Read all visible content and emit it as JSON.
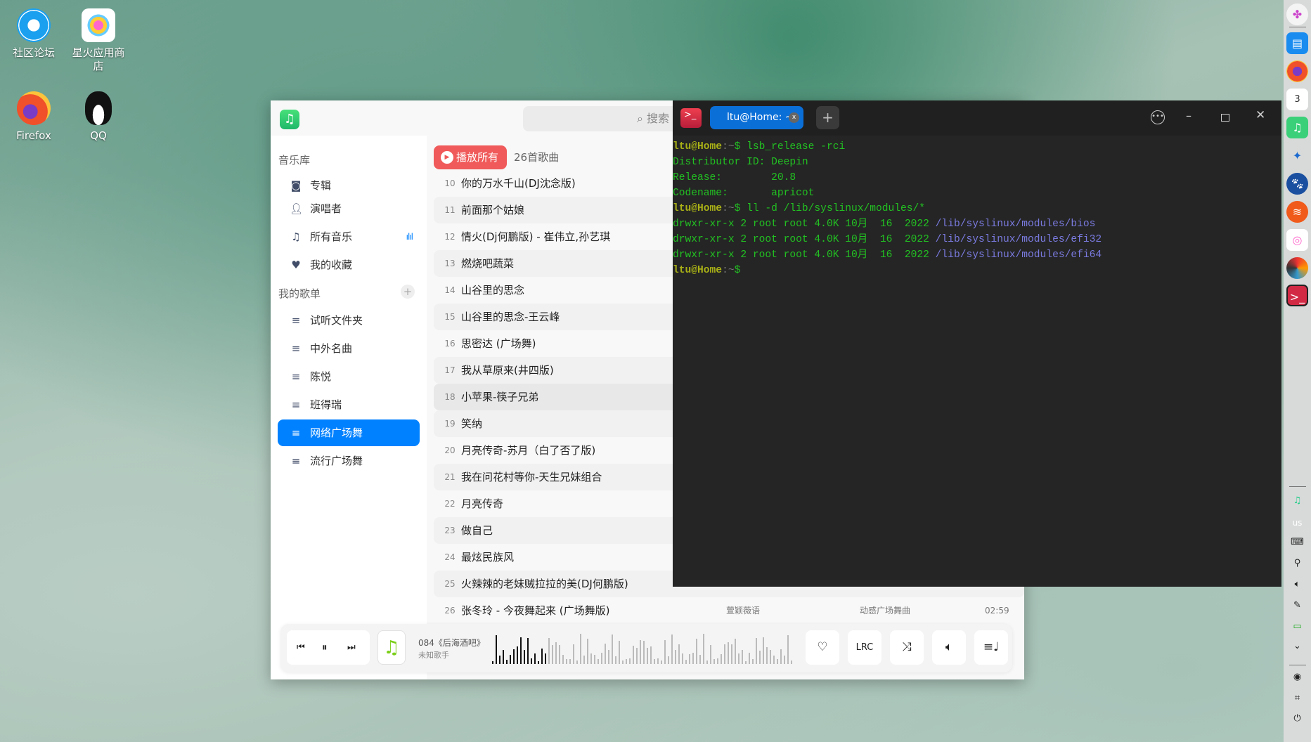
{
  "desktop": {
    "icons": [
      {
        "label": "社区论坛"
      },
      {
        "label": "星火应用商店"
      },
      {
        "label": "Firefox"
      },
      {
        "label": "QQ"
      }
    ]
  },
  "music": {
    "search_placeholder": "搜索",
    "sidebar": {
      "library_title": "音乐库",
      "library": [
        {
          "label": "专辑",
          "icon": "album-icon"
        },
        {
          "label": "演唱者",
          "icon": "artist-icon"
        },
        {
          "label": "所有音乐",
          "icon": "music-note-icon"
        },
        {
          "label": "我的收藏",
          "icon": "heart-icon"
        }
      ],
      "playlists_title": "我的歌单",
      "playlists": [
        "试听文件夹",
        "中外名曲",
        "陈悦",
        "班得瑞",
        "网络广场舞",
        "流行广场舞"
      ],
      "selected": "网络广场舞"
    },
    "play_all": "播放所有",
    "count": "26首歌曲",
    "songs": [
      {
        "n": "10",
        "t": "你的万水千山(DJ沈念版)"
      },
      {
        "n": "11",
        "t": "前面那个姑娘"
      },
      {
        "n": "12",
        "t": "情火(Dj何鹏版) - 崔伟立,孙艺琪"
      },
      {
        "n": "13",
        "t": "燃烧吧蔬菜"
      },
      {
        "n": "14",
        "t": "山谷里的思念"
      },
      {
        "n": "15",
        "t": "山谷里的思念-王云峰"
      },
      {
        "n": "16",
        "t": "思密达 (广场舞)"
      },
      {
        "n": "17",
        "t": "我从草原来(井四版)"
      },
      {
        "n": "18",
        "t": "小苹果-筷子兄弟"
      },
      {
        "n": "19",
        "t": "笑纳"
      },
      {
        "n": "20",
        "t": "月亮传奇-苏月（白了否了版)"
      },
      {
        "n": "21",
        "t": "我在问花村等你-天生兄妹组合"
      },
      {
        "n": "22",
        "t": "月亮传奇"
      },
      {
        "n": "23",
        "t": "做自己"
      },
      {
        "n": "24",
        "t": "最炫民族风"
      },
      {
        "n": "25",
        "t": "火辣辣的老妹贼拉拉的美(DJ何鹏版)"
      },
      {
        "n": "26",
        "t": "张冬玲 - 今夜舞起来 (广场舞版)",
        "artist": "萱颖薇语",
        "album": "动感广场舞曲",
        "duration": "02:59"
      }
    ],
    "player": {
      "title": "084《后海酒吧》",
      "artist": "未知歌手",
      "progress": 0.18,
      "lrc": "LRC"
    }
  },
  "terminal": {
    "tab": "ltu@Home: ~",
    "lines": [
      [
        [
          "u",
          "ltu@Home"
        ],
        [
          "d",
          ":~"
        ],
        [
          "g",
          "$ lsb_release -rci"
        ]
      ],
      [
        [
          "g",
          "Distributor ID: Deepin"
        ]
      ],
      [
        [
          "g",
          "Release:        20.8"
        ]
      ],
      [
        [
          "g",
          "Codename:       apricot"
        ]
      ],
      [
        [
          "u",
          "ltu@Home"
        ],
        [
          "d",
          ":~"
        ],
        [
          "g",
          "$ ll -d /lib/syslinux/modules/*"
        ]
      ],
      [
        [
          "g",
          "drwxr-xr-x 2 root root 4.0K 10月  16  2022 "
        ],
        [
          "p",
          "/lib/syslinux/modules/bios"
        ]
      ],
      [
        [
          "g",
          "drwxr-xr-x 2 root root 4.0K 10月  16  2022 "
        ],
        [
          "p",
          "/lib/syslinux/modules/efi32"
        ]
      ],
      [
        [
          "g",
          "drwxr-xr-x 2 root root 4.0K 10月  16  2022 "
        ],
        [
          "p",
          "/lib/syslinux/modules/efi64"
        ]
      ],
      [
        [
          "u",
          "ltu@Home"
        ],
        [
          "d",
          ":~"
        ],
        [
          "g",
          "$"
        ]
      ]
    ]
  },
  "dock": {
    "tray_keyboard_layout": "us"
  },
  "colors": {
    "accent": "#0081ff",
    "play_all": "#f05a5a",
    "terminal_green": "#22c022",
    "terminal_path": "#7a7ae0"
  }
}
